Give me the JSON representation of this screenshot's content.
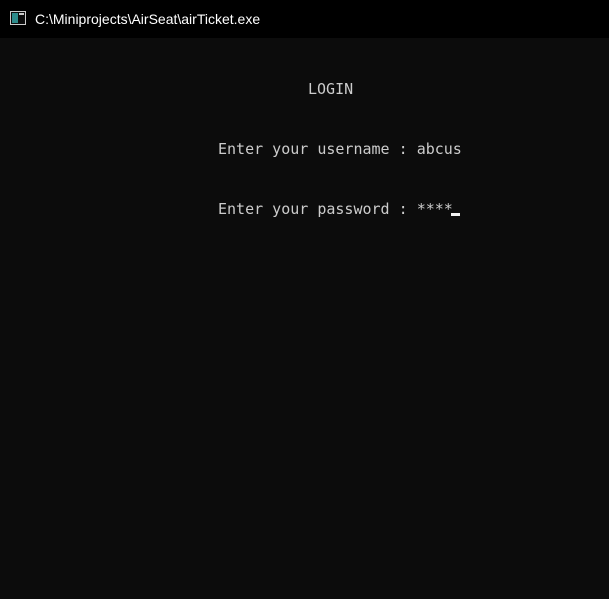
{
  "window": {
    "title": "C:\\Miniprojects\\AirSeat\\airTicket.exe",
    "icon": "console-app-icon"
  },
  "console": {
    "heading": "LOGIN",
    "username_prompt": "Enter your username : ",
    "username_value": "abcus",
    "password_prompt": "Enter your password : ",
    "password_value": "****"
  },
  "colors": {
    "background": "#0c0c0c",
    "titlebar": "#000000",
    "text": "#cccccc"
  }
}
